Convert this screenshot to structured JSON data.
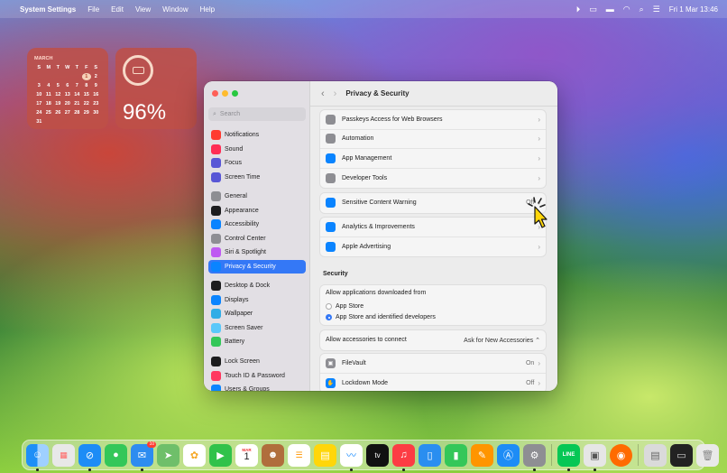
{
  "menubar": {
    "app_name": "System Settings",
    "menus": [
      "File",
      "Edit",
      "View",
      "Window",
      "Help"
    ],
    "clock": "Fri 1 Mar  13:46"
  },
  "calendar_widget": {
    "month": "MARCH",
    "weekdays": [
      "S",
      "M",
      "T",
      "W",
      "T",
      "F",
      "S"
    ],
    "days": [
      "",
      "",
      "",
      "",
      "",
      "1",
      "2",
      "3",
      "4",
      "5",
      "6",
      "7",
      "8",
      "9",
      "10",
      "11",
      "12",
      "13",
      "14",
      "15",
      "16",
      "17",
      "18",
      "19",
      "20",
      "21",
      "22",
      "23",
      "24",
      "25",
      "26",
      "27",
      "28",
      "29",
      "30",
      "31"
    ],
    "today": "1"
  },
  "battery_widget": {
    "percent": "96%"
  },
  "window": {
    "title": "Privacy & Security",
    "search_placeholder": "Search",
    "sidebar": {
      "group1": [
        {
          "label": "Notifications",
          "color": "#ff3b30"
        },
        {
          "label": "Sound",
          "color": "#ff2d55"
        },
        {
          "label": "Focus",
          "color": "#5856d6"
        },
        {
          "label": "Screen Time",
          "color": "#5856d6"
        }
      ],
      "group2": [
        {
          "label": "General",
          "color": "#8e8e93"
        },
        {
          "label": "Appearance",
          "color": "#1c1c1e"
        },
        {
          "label": "Accessibility",
          "color": "#0a84ff"
        },
        {
          "label": "Control Center",
          "color": "#8e8e93"
        },
        {
          "label": "Siri & Spotlight",
          "color": "#bf5af2"
        },
        {
          "label": "Privacy & Security",
          "color": "#0a84ff"
        }
      ],
      "group3": [
        {
          "label": "Desktop & Dock",
          "color": "#1c1c1e"
        },
        {
          "label": "Displays",
          "color": "#0a84ff"
        },
        {
          "label": "Wallpaper",
          "color": "#32ade6"
        },
        {
          "label": "Screen Saver",
          "color": "#5ac8fa"
        },
        {
          "label": "Battery",
          "color": "#34c759"
        }
      ],
      "group4": [
        {
          "label": "Lock Screen",
          "color": "#1c1c1e"
        },
        {
          "label": "Touch ID & Password",
          "color": "#ff375f"
        },
        {
          "label": "Users & Groups",
          "color": "#0a84ff"
        }
      ]
    },
    "rows_top": [
      {
        "label": "Passkeys Access for Web Browsers",
        "color": "#8e8e93"
      },
      {
        "label": "Automation",
        "color": "#8e8e93"
      },
      {
        "label": "App Management",
        "color": "#0a84ff"
      },
      {
        "label": "Developer Tools",
        "color": "#8e8e93"
      }
    ],
    "rows_mid": [
      {
        "label": "Sensitive Content Warning",
        "color": "#0a84ff",
        "value": "Off"
      }
    ],
    "rows_analytics": [
      {
        "label": "Analytics & Improvements",
        "color": "#0a84ff"
      },
      {
        "label": "Apple Advertising",
        "color": "#0a84ff"
      }
    ],
    "security": {
      "heading": "Security",
      "allow_label": "Allow applications downloaded from",
      "option1": "App Store",
      "option2": "App Store and identified developers",
      "accessories_label": "Allow accessories to connect",
      "accessories_value": "Ask for New Accessories",
      "filevault_label": "FileVault",
      "filevault_value": "On",
      "lockdown_label": "Lockdown Mode",
      "lockdown_value": "Off"
    }
  },
  "dock": {
    "mail_badge": "10",
    "calendar_month": "MAR",
    "calendar_day": "1",
    "tv_label": "tv",
    "line_label": "LINE"
  }
}
